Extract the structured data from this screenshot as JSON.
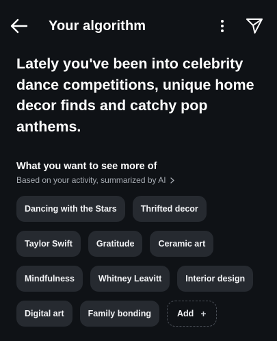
{
  "header": {
    "title": "Your algorithm",
    "back_icon": "arrow-left-icon",
    "more_icon": "more-vertical-icon",
    "send_icon": "send-icon"
  },
  "headline": "Lately you've been into celebrity dance competitions, unique home decor finds and catchy pop anthems.",
  "section": {
    "title": "What you want to see more of",
    "subtitle": "Based on your activity, summarized by AI"
  },
  "interests": {
    "rows": [
      [
        "Dancing with the Stars",
        "Thrifted decor"
      ],
      [
        "Taylor Swift",
        "Gratitude",
        "Ceramic art"
      ],
      [
        "Mindfulness",
        "Whitney Leavitt",
        "Interior design"
      ],
      [
        "Digital art",
        "Family bonding"
      ]
    ],
    "add_label": "Add",
    "add_symbol": "+"
  },
  "colors": {
    "background": "#0f1216",
    "chip": "#262a30",
    "subtitle": "#a7acb3"
  }
}
